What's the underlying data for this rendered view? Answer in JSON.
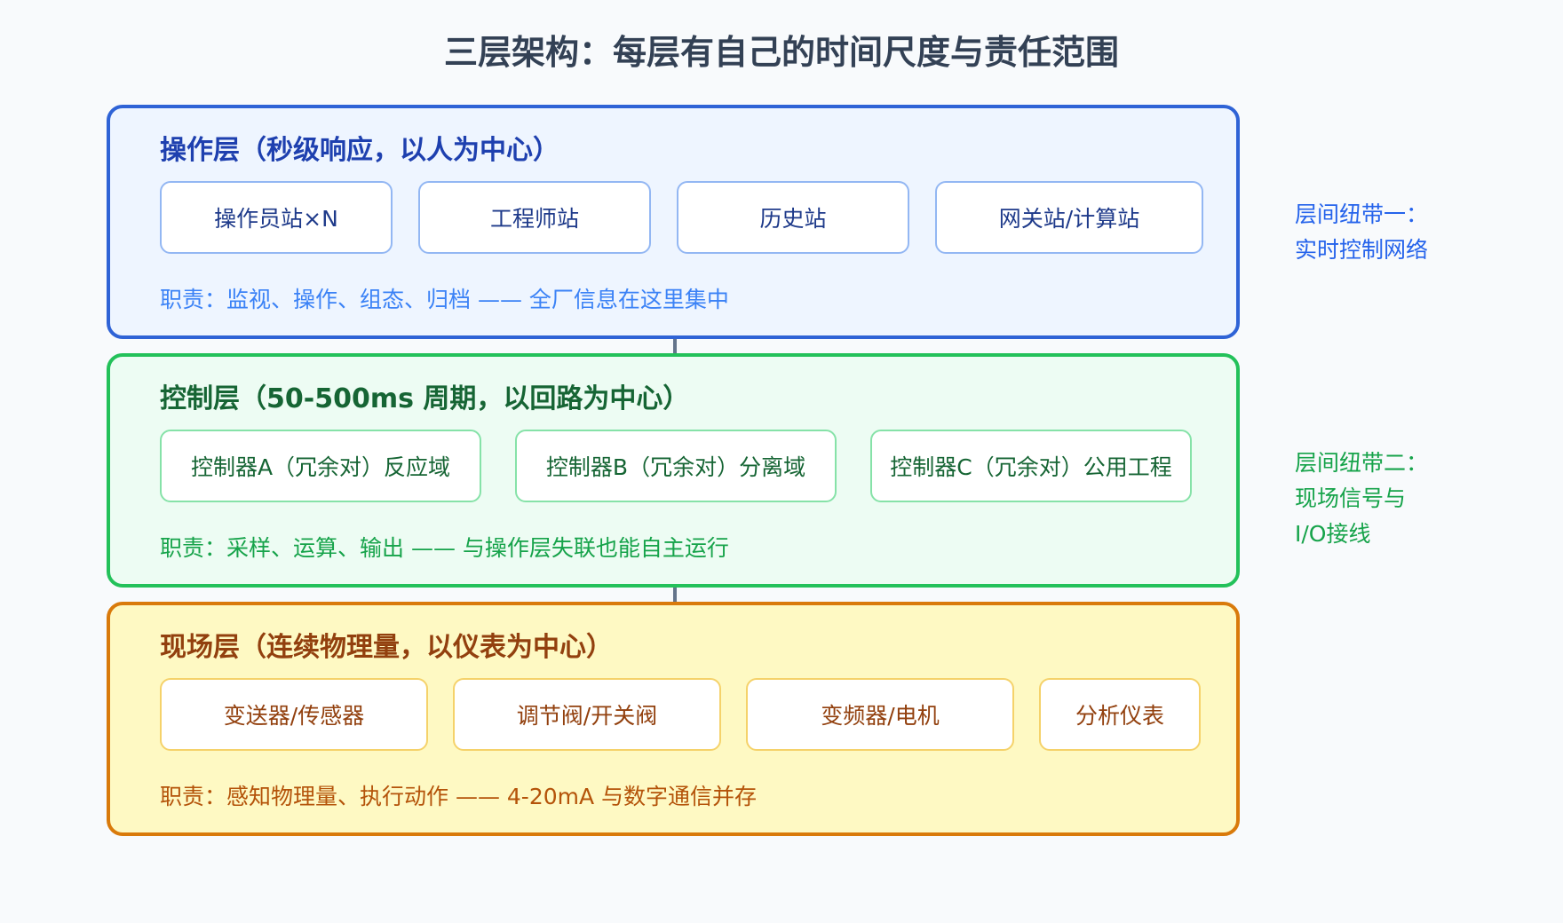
{
  "title": "三层架构：每层有自己的时间尺度与责任范围",
  "layers": [
    {
      "title": "操作层（秒级响应，以人为中心）",
      "nodes": [
        "操作员站×N",
        "工程师站",
        "历史站",
        "网关站/计算站"
      ],
      "duty": "职责：监视、操作、组态、归档 —— 全厂信息在这里集中",
      "color": "#2f63d6"
    },
    {
      "title": "控制层（50-500ms 周期，以回路为中心）",
      "nodes": [
        "控制器A（冗余对）反应域",
        "控制器B（冗余对）分离域",
        "控制器C（冗余对）公用工程"
      ],
      "duty": "职责：采样、运算、输出 —— 与操作层失联也能自主运行",
      "color": "#23c15a"
    },
    {
      "title": "现场层（连续物理量，以仪表为中心）",
      "nodes": [
        "变送器/传感器",
        "调节阀/开关阀",
        "变频器/电机",
        "分析仪表"
      ],
      "duty": "职责：感知物理量、执行动作 —— 4-20mA 与数字通信并存",
      "color": "#d97a0b"
    }
  ],
  "links": [
    {
      "lines": [
        "层间纽带一：",
        "实时控制网络"
      ],
      "color": "#2563eb"
    },
    {
      "lines": [
        "层间纽带二：",
        "现场信号与",
        "I/O接线"
      ],
      "color": "#16a34a"
    }
  ]
}
